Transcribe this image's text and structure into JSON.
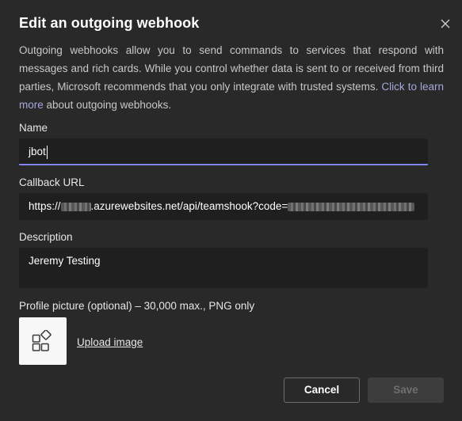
{
  "dialog": {
    "title": "Edit an outgoing webhook",
    "close_icon": "close-icon",
    "description": "Outgoing webhooks allow you to send commands to services that respond with messages and rich cards. While you control whether data is sent to or received from third parties, Microsoft recommends that you only integrate with trusted systems.",
    "learn_more_link": "Click to learn more",
    "learn_more_suffix": "about outgoing webhooks."
  },
  "form": {
    "name_label": "Name",
    "name_value": "jbot",
    "callback_label": "Callback URL",
    "callback_prefix": "https://",
    "callback_middle": ".azurewebsites.net/api/teamshook?code=",
    "description_label": "Description",
    "description_value": "Jeremy Testing",
    "profile_label": "Profile picture (optional) – 30,000 max., PNG only",
    "upload_label": "Upload image",
    "app_icon": "apps-add-icon"
  },
  "footer": {
    "cancel_label": "Cancel",
    "save_label": "Save"
  },
  "colors": {
    "background": "#292929",
    "field_background": "#1f1f1f",
    "link": "#a6a7dc",
    "focus_underline": "#7f85f5"
  }
}
